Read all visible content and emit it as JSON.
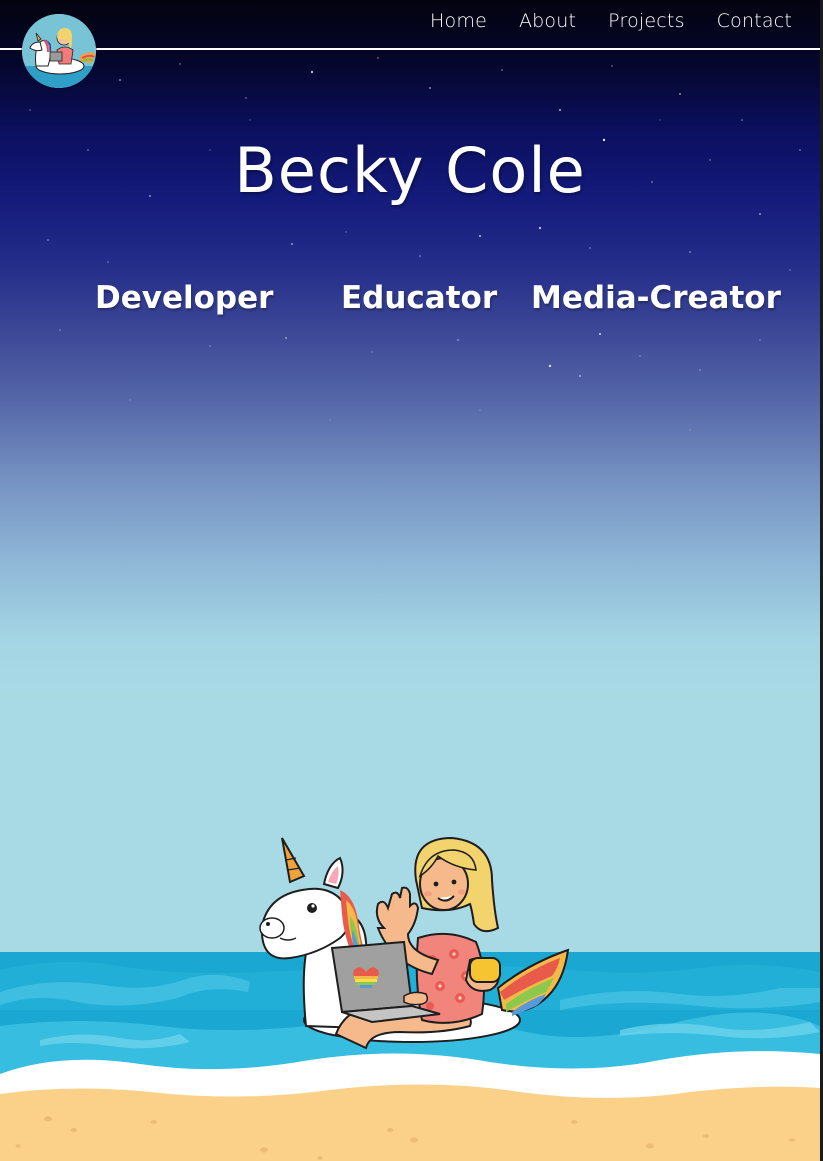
{
  "nav": {
    "links": [
      "Home",
      "About",
      "Projects",
      "Contact"
    ]
  },
  "logo": {
    "icon": "unicorn-float-avatar-icon"
  },
  "hero": {
    "title": "Becky Cole",
    "roles": [
      "Developer",
      "Educator",
      "Media-Creator"
    ]
  },
  "illustration": {
    "icon": "girl-on-unicorn-float-with-laptop-illustration"
  },
  "colors": {
    "sky_top": "#03030f",
    "sky_mid": "#141b7c",
    "sky_bottom": "#a8dae6",
    "sea": "#1aa7d1",
    "foam": "#ffffff",
    "sand": "#fbd18a",
    "text": "#ffffff"
  }
}
